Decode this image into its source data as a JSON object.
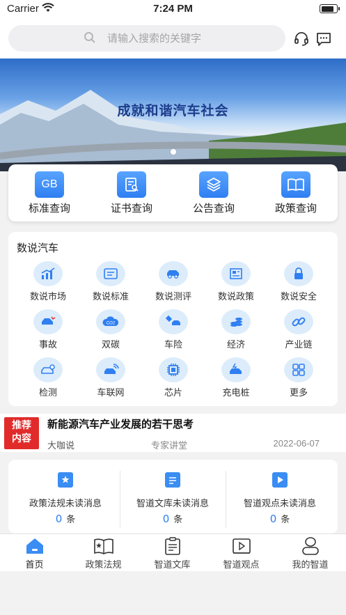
{
  "status_bar": {
    "carrier": "Carrier",
    "time": "7:24 PM",
    "battery_level": 0.85
  },
  "search": {
    "placeholder": "请输入搜索的关键字"
  },
  "header_icons": [
    "customer-service-icon",
    "message-icon"
  ],
  "banner": {
    "title": "成就和谐汽车社会",
    "slides": 2,
    "active_slide": 0
  },
  "quick_actions": [
    {
      "label": "标准查询",
      "icon": "gb-standard-icon",
      "icon_text": "GB"
    },
    {
      "label": "证书查询",
      "icon": "certificate-search-icon"
    },
    {
      "label": "公告查询",
      "icon": "announcement-layers-icon"
    },
    {
      "label": "政策查询",
      "icon": "policy-book-icon"
    }
  ],
  "data_section": {
    "heading": "数说汽车",
    "items": [
      {
        "label": "数说市场",
        "icon": "market-chart-icon"
      },
      {
        "label": "数说标准",
        "icon": "standard-doc-icon"
      },
      {
        "label": "数说测评",
        "icon": "car-test-icon"
      },
      {
        "label": "数说政策",
        "icon": "policy-news-icon"
      },
      {
        "label": "数说安全",
        "icon": "security-lock-icon"
      },
      {
        "label": "事故",
        "icon": "accident-car-icon"
      },
      {
        "label": "双碳",
        "icon": "co2-cloud-icon"
      },
      {
        "label": "车险",
        "icon": "car-insurance-icon"
      },
      {
        "label": "经济",
        "icon": "economy-coins-icon"
      },
      {
        "label": "产业链",
        "icon": "chain-link-icon"
      },
      {
        "label": "检测",
        "icon": "car-inspection-icon"
      },
      {
        "label": "车联网",
        "icon": "connected-car-icon"
      },
      {
        "label": "芯片",
        "icon": "chip-icon"
      },
      {
        "label": "充电桩",
        "icon": "charging-car-icon"
      },
      {
        "label": "更多",
        "icon": "more-grid-icon"
      }
    ]
  },
  "recommended": {
    "badge_line1": "推荐",
    "badge_line2": "内容",
    "title": "新能源汽车产业发展的若干思考",
    "author": "大咖说",
    "category": "专家讲堂",
    "date": "2022-06-07"
  },
  "unread": [
    {
      "label": "政策法规未读消息",
      "count": "0",
      "unit": "条",
      "icon": "policy-star-icon"
    },
    {
      "label": "智道文库未读消息",
      "count": "0",
      "unit": "条",
      "icon": "library-doc-icon"
    },
    {
      "label": "智道观点未读消息",
      "count": "0",
      "unit": "条",
      "icon": "video-play-icon"
    }
  ],
  "tabs": [
    {
      "label": "首页",
      "icon": "home-icon",
      "active": true
    },
    {
      "label": "政策法规",
      "icon": "policy-tab-icon"
    },
    {
      "label": "智道文库",
      "icon": "library-tab-icon"
    },
    {
      "label": "智道观点",
      "icon": "viewpoint-tab-icon"
    },
    {
      "label": "我的智道",
      "icon": "profile-icon"
    }
  ],
  "colors": {
    "accent": "#2f7ff2",
    "badge_red": "#e12b2b",
    "icon_bg": "#dcecfb"
  }
}
